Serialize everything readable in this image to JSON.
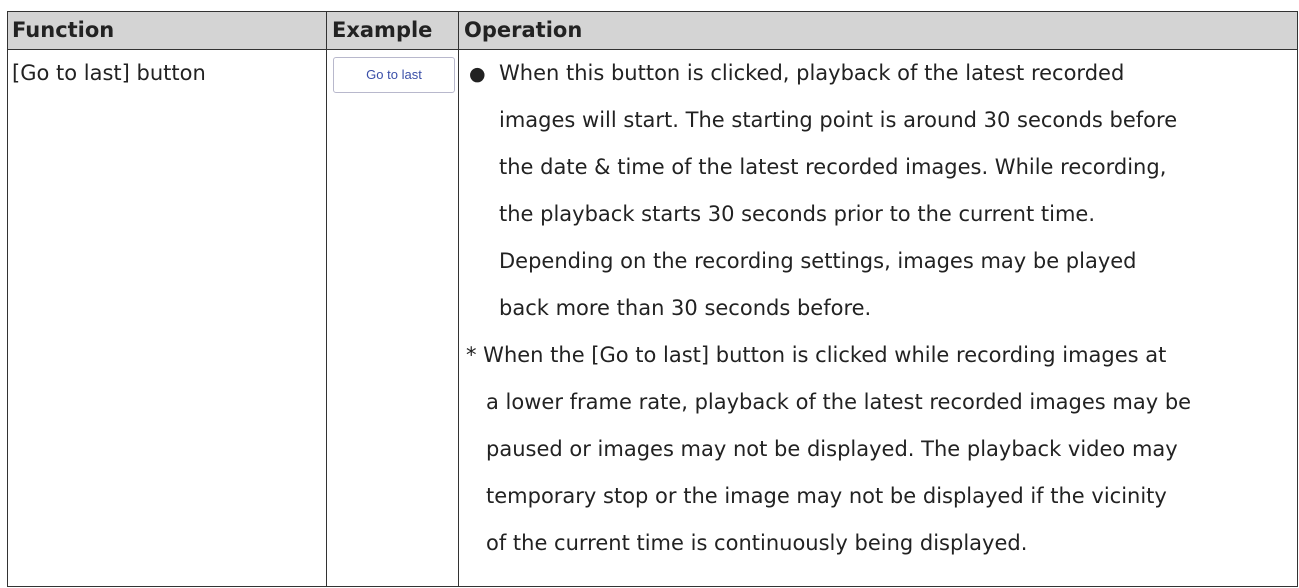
{
  "table": {
    "headers": {
      "function": "Function",
      "example": "Example",
      "operation": "Operation"
    },
    "rows": [
      {
        "function": "[Go to last] button",
        "example_button_label": "Go to last",
        "operation": {
          "bullet_symbol": "●",
          "bullet_lines": [
            "When this button is clicked, playback of the latest recorded",
            "images will start. The starting point is around 30 seconds before",
            "the date & time of the latest recorded images. While recording,",
            "the playback starts 30 seconds prior to the current time.",
            "Depending on the recording settings, images may be played",
            "back more than 30 seconds before."
          ],
          "note_lines": [
            "* When the [Go to last] button is clicked while recording images at",
            "a lower frame rate, playback of the latest recorded images may be",
            "paused or images may not be displayed. The playback video may",
            "temporary stop or the image may not be displayed if the vicinity",
            "of the current time is continuously being displayed."
          ]
        }
      }
    ]
  },
  "colors": {
    "header_background": "#d4d4d4",
    "border": "#333333",
    "button_text": "#3a4fa8"
  }
}
